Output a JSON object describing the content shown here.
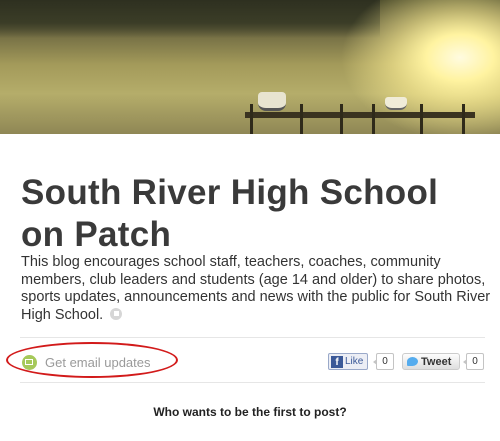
{
  "page": {
    "title": "South River High School on Patch",
    "description": "This blog encourages school staff, teachers, coaches, community members, club leaders and students (age 14 and older) to share photos, sports updates, announcements and news with the public for South River High School."
  },
  "actions": {
    "email_updates_label": "Get email updates",
    "email_icon": "envelope-icon",
    "flag_icon": "flag-icon"
  },
  "social": {
    "facebook_icon_letter": "f",
    "facebook_like_label": "Like",
    "facebook_count": "0",
    "twitter_icon": "twitter-bird-icon",
    "tweet_label": "Tweet",
    "tweet_count": "0"
  },
  "feed": {
    "empty_prompt": "Who wants to be the first to post?"
  },
  "colors": {
    "highlight_circle": "#d21a1a",
    "email_icon": "#a6c95a",
    "facebook_blue": "#3b5998",
    "twitter_blue": "#55acee"
  }
}
